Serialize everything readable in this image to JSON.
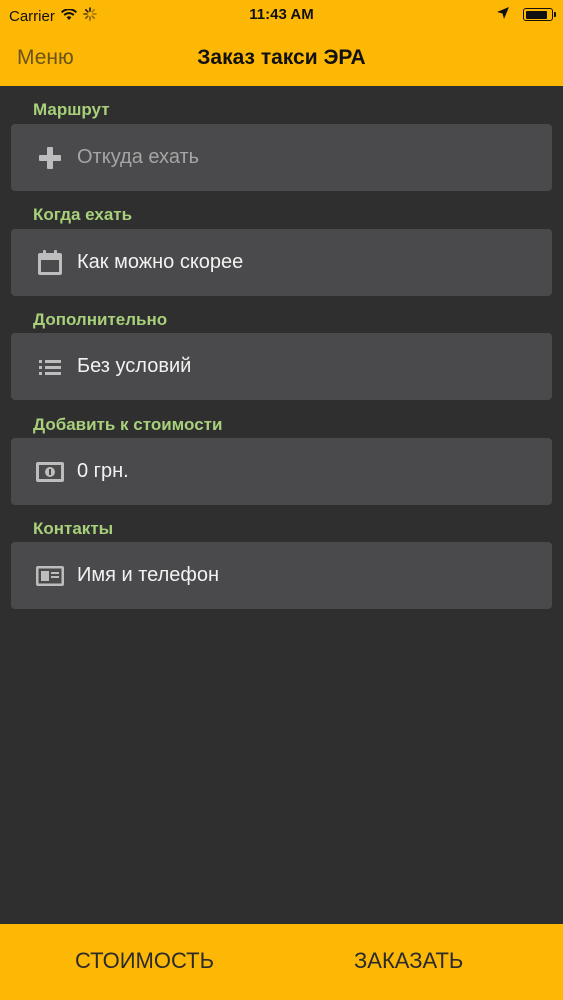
{
  "status_bar": {
    "carrier": "Carrier",
    "time": "11:43 AM",
    "battery_level": 0.85
  },
  "nav": {
    "menu_label": "Меню",
    "title": "Заказ такси ЭРА"
  },
  "sections": {
    "route": {
      "label": "Маршрут",
      "placeholder": "Откуда ехать",
      "icon": "plus-icon"
    },
    "when": {
      "label": "Когда ехать",
      "value": "Как можно скорее",
      "icon": "calendar-icon"
    },
    "extra": {
      "label": "Дополнительно",
      "value": "Без условий",
      "icon": "list-icon"
    },
    "add_cost": {
      "label": "Добавить к стоимости",
      "value": "0 грн.",
      "icon": "money-icon"
    },
    "contacts": {
      "label": "Контакты",
      "value": "Имя и телефон",
      "icon": "contact-card-icon"
    }
  },
  "footer": {
    "cost_label": "СТОИМОСТЬ",
    "order_label": "ЗАКАЗАТЬ"
  },
  "colors": {
    "accent": "#fdb806",
    "background": "#2f2f30",
    "row": "#4a4a4c",
    "section_label": "#a8d07a"
  }
}
